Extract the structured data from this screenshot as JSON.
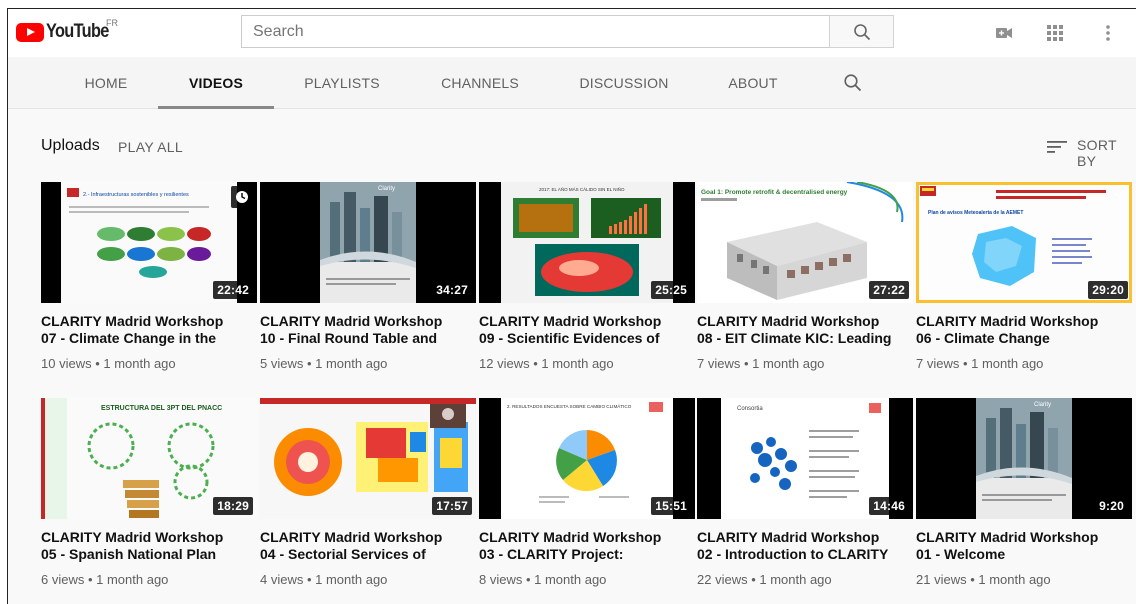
{
  "masthead": {
    "logo_text": "YouTube",
    "country": "FR",
    "search_placeholder": "Search",
    "icons": [
      "video-camera-icon",
      "apps-grid-icon",
      "more-vertical-icon"
    ]
  },
  "tabs": [
    {
      "label": "HOME",
      "active": false
    },
    {
      "label": "VIDEOS",
      "active": true
    },
    {
      "label": "PLAYLISTS",
      "active": false
    },
    {
      "label": "CHANNELS",
      "active": false
    },
    {
      "label": "DISCUSSION",
      "active": false
    },
    {
      "label": "ABOUT",
      "active": false
    }
  ],
  "uploads": {
    "title": "Uploads",
    "play_all": "PLAY ALL",
    "sort_by": "SORT BY"
  },
  "videos": [
    {
      "title": "CLARITY Madrid Workshop\n07 - Climate Change in the",
      "views": "10 views",
      "age": "1 month ago",
      "duration": "22:42",
      "thumb_text": "2.- Infraestructuras sostenibles y resilientes"
    },
    {
      "title": "CLARITY Madrid Workshop\n10 - Final Round Table and",
      "views": "5 views",
      "age": "1 month ago",
      "duration": "34:27",
      "thumb_text": "Clarity"
    },
    {
      "title": "CLARITY Madrid Workshop\n09 - Scientific Evidences of",
      "views": "12 views",
      "age": "1 month ago",
      "duration": "25:25",
      "thumb_text": "2017: EL AÑO MÁS CÁLIDO SIN EL NIÑO"
    },
    {
      "title": "CLARITY Madrid Workshop\n08 - EIT Climate KIC: Leading",
      "views": "7 views",
      "age": "1 month ago",
      "duration": "27:22",
      "thumb_text": "Goal 1: Promote retrofit & decentralised energy"
    },
    {
      "title": "CLARITY Madrid Workshop\n06 - Climate Change",
      "views": "7 views",
      "age": "1 month ago",
      "duration": "29:20",
      "thumb_text": "Plan de avisos Meteoalerta de la AEMET"
    },
    {
      "title": "CLARITY Madrid Workshop\n05 - Spanish National Plan",
      "views": "6 views",
      "age": "1 month ago",
      "duration": "18:29",
      "thumb_text": "ESTRUCTURA DEL 3PT DEL PNACC"
    },
    {
      "title": "CLARITY Madrid Workshop\n04 - Sectorial Services of",
      "views": "4 views",
      "age": "1 month ago",
      "duration": "17:57",
      "thumb_text": ""
    },
    {
      "title": "CLARITY Madrid Workshop\n03 - CLARITY Project:",
      "views": "8 views",
      "age": "1 month ago",
      "duration": "15:51",
      "thumb_text": "2. RESULTADOS ENCUESTA SOBRE CAMBIO CLIMÁTICO"
    },
    {
      "title": "CLARITY Madrid Workshop\n02 - Introduction to CLARITY",
      "views": "22 views",
      "age": "1 month ago",
      "duration": "14:46",
      "thumb_text": "Consortia"
    },
    {
      "title": "CLARITY Madrid Workshop\n01 - Welcome",
      "views": "21 views",
      "age": "1 month ago",
      "duration": "9:20",
      "thumb_text": "Clarity"
    }
  ],
  "colors": {
    "brand_red": "#ff0000",
    "tab_underline": "#888888",
    "meta_text": "#606060"
  }
}
